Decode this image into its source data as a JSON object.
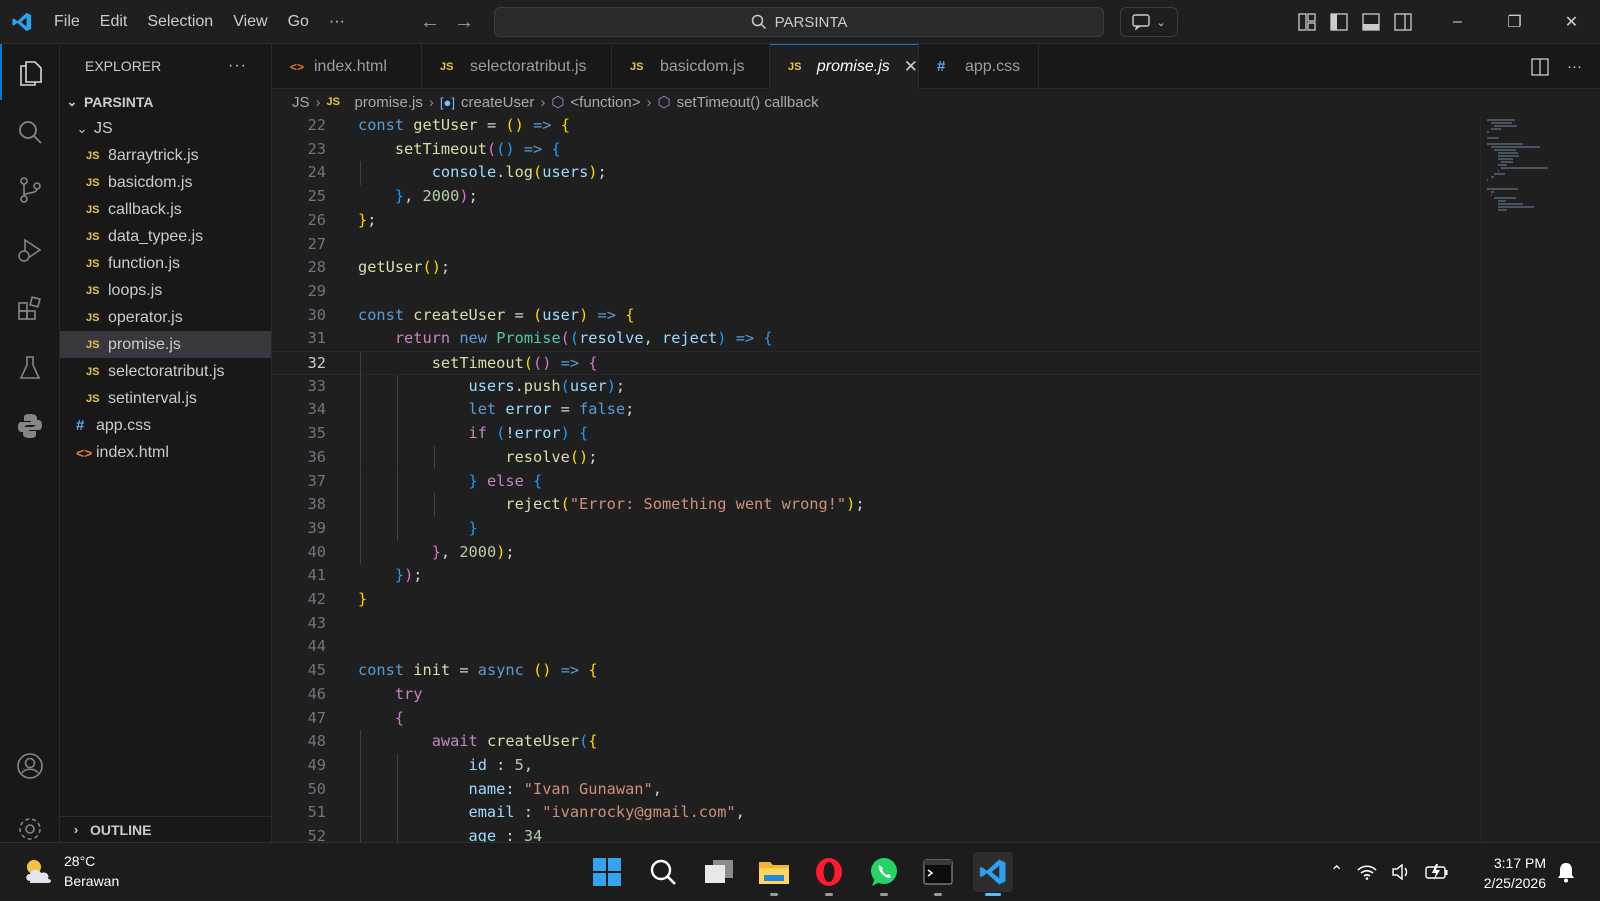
{
  "window": {
    "menu": [
      "File",
      "Edit",
      "Selection",
      "View",
      "Go",
      "···"
    ],
    "search_text": "PARSINTA"
  },
  "sidebar": {
    "title": "EXPLORER",
    "root": "PARSINTA",
    "folder": "JS",
    "js_files": [
      "8arraytrick.js",
      "basicdom.js",
      "callback.js",
      "data_typee.js",
      "function.js",
      "loops.js",
      "operator.js",
      "promise.js",
      "selectoratribut.js",
      "setinterval.js"
    ],
    "selected_file": "promise.js",
    "css_file": "app.css",
    "html_file": "index.html",
    "outline": "OUTLINE"
  },
  "tabs": [
    {
      "label": "index.html",
      "icon": "html-icon",
      "active": false
    },
    {
      "label": "selectoratribut.js",
      "icon": "js-icon",
      "active": false
    },
    {
      "label": "basicdom.js",
      "icon": "js-icon",
      "active": false
    },
    {
      "label": "promise.js",
      "icon": "js-icon",
      "active": true
    },
    {
      "label": "app.css",
      "icon": "css-icon",
      "active": false
    }
  ],
  "breadcrumb": [
    "JS",
    "promise.js",
    "createUser",
    "<function>",
    "setTimeout() callback"
  ],
  "editor": {
    "current_line": 32,
    "lines": [
      {
        "n": "22",
        "t": "const getUser = () => {"
      },
      {
        "n": "23",
        "t": "    setTimeout(() => {"
      },
      {
        "n": "24",
        "t": "        console.log(users);"
      },
      {
        "n": "25",
        "t": "    }, 2000);"
      },
      {
        "n": "26",
        "t": "};"
      },
      {
        "n": "27",
        "t": ""
      },
      {
        "n": "28",
        "t": "getUser();"
      },
      {
        "n": "29",
        "t": ""
      },
      {
        "n": "30",
        "t": "const createUser = (user) => {"
      },
      {
        "n": "31",
        "t": "    return new Promise((resolve, reject) => {"
      },
      {
        "n": "32",
        "t": "        setTimeout(() => {"
      },
      {
        "n": "33",
        "t": "            users.push(user);"
      },
      {
        "n": "34",
        "t": "            let error = false;"
      },
      {
        "n": "35",
        "t": "            if (!error) {"
      },
      {
        "n": "36",
        "t": "                resolve();"
      },
      {
        "n": "37",
        "t": "            } else {"
      },
      {
        "n": "38",
        "t": "                reject(\"Error: Something went wrong!\");"
      },
      {
        "n": "39",
        "t": "            }"
      },
      {
        "n": "40",
        "t": "        }, 2000);"
      },
      {
        "n": "41",
        "t": "    });"
      },
      {
        "n": "42",
        "t": "}"
      },
      {
        "n": "43",
        "t": ""
      },
      {
        "n": "44",
        "t": ""
      },
      {
        "n": "45",
        "t": "const init = async () => {"
      },
      {
        "n": "46",
        "t": "    try"
      },
      {
        "n": "47",
        "t": "    {"
      },
      {
        "n": "48",
        "t": "        await createUser({"
      },
      {
        "n": "49",
        "t": "            id : 5,"
      },
      {
        "n": "50",
        "t": "            name: \"Ivan Gunawan\","
      },
      {
        "n": "51",
        "t": "            email : \"ivanrocky@gmail.com\","
      },
      {
        "n": "52",
        "t": "            age : 34"
      }
    ]
  },
  "taskbar": {
    "temperature": "28°C",
    "weather": "Berawan",
    "time": "3:17 PM",
    "date": "2/25/2026"
  },
  "colors": {
    "accent": "#0078d4",
    "keyword": "#569cd6",
    "control": "#c586c0",
    "function": "#dcdcaa",
    "variable": "#9cdcfe",
    "string": "#ce9178",
    "number": "#b5cea8"
  }
}
